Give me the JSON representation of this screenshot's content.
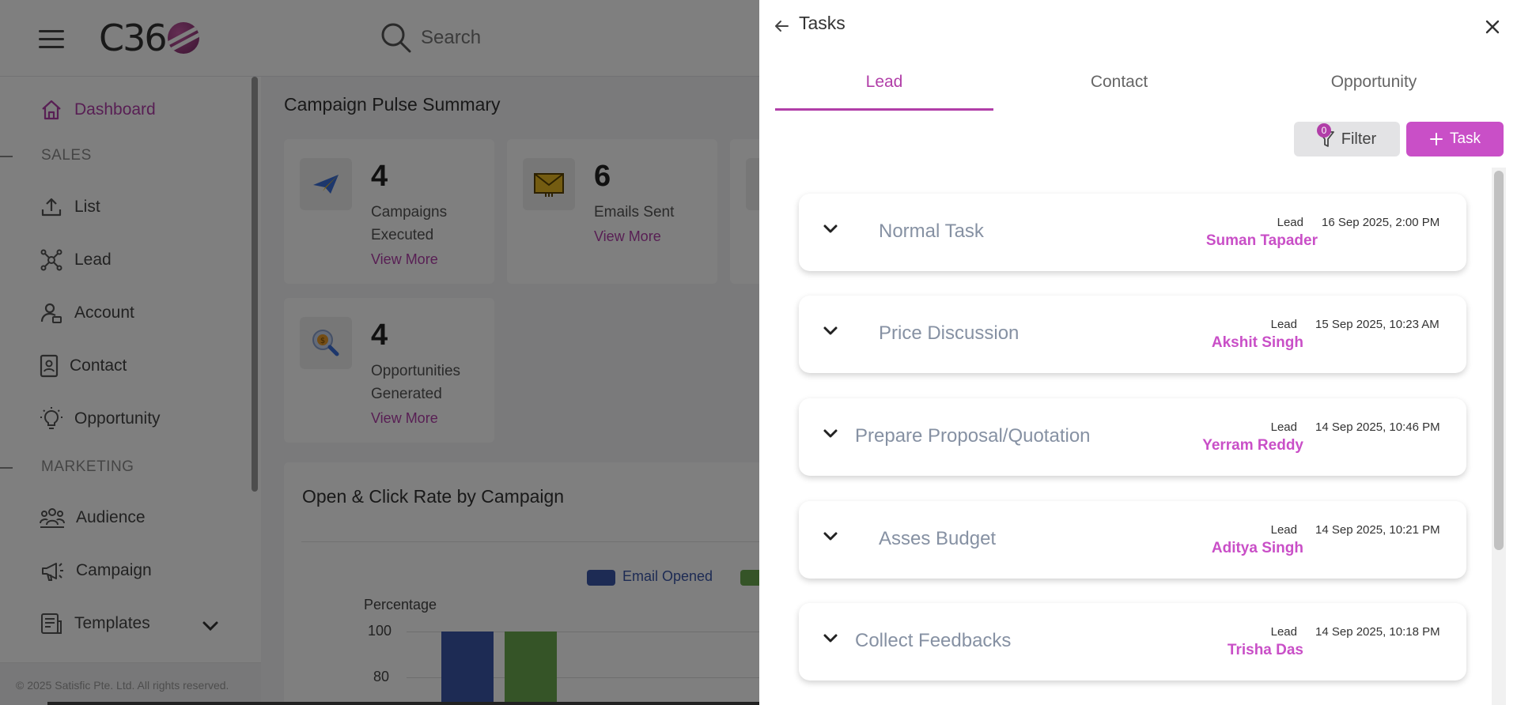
{
  "app": {
    "logo_text": "C36",
    "search_placeholder": "Search",
    "sidebar": {
      "items": [
        {
          "label": "Dashboard",
          "icon": "home-icon",
          "active": true
        },
        {
          "label": "List",
          "icon": "upload-icon"
        },
        {
          "label": "Lead",
          "icon": "network-icon"
        },
        {
          "label": "Account",
          "icon": "account-icon"
        },
        {
          "label": "Contact",
          "icon": "contact-icon"
        },
        {
          "label": "Opportunity",
          "icon": "lightbulb-icon"
        },
        {
          "label": "Audience",
          "icon": "audience-icon"
        },
        {
          "label": "Campaign",
          "icon": "megaphone-icon"
        },
        {
          "label": "Templates",
          "icon": "templates-icon"
        }
      ],
      "sections": {
        "sales": "SALES",
        "marketing": "MARKETING"
      },
      "footer": "© 2025 Satisfic Pte. Ltd. All rights reserved."
    },
    "dashboard": {
      "pulse_title": "Campaign Pulse Summary",
      "cards": [
        {
          "value": "4",
          "label": "Campaigns Executed",
          "link": "View More",
          "icon": "paper-plane-icon"
        },
        {
          "value": "6",
          "label": "Emails Sent",
          "link": "View More",
          "icon": "envelope-icon"
        },
        {
          "value": "4",
          "label": "Opportunities Generated",
          "link": "View More",
          "icon": "coin-search-icon"
        }
      ],
      "chart_title": "Open & Click Rate by Campaign",
      "legend_opened": "Email Opened",
      "ylabel": "Percentage",
      "y_ticks": [
        "100",
        "80"
      ]
    },
    "colors": {
      "accent": "#b13ea8",
      "button": "#c94fc7",
      "bar_opened": "#3a56a8",
      "bar_clicked": "#6aa84f"
    }
  },
  "drawer": {
    "title": "Tasks",
    "tabs": [
      {
        "label": "Lead",
        "active": true
      },
      {
        "label": "Contact",
        "active": false
      },
      {
        "label": "Opportunity",
        "active": false
      }
    ],
    "filter_label": "Filter",
    "filter_count": "0",
    "add_task_label": "Task",
    "tasks": [
      {
        "name": "Normal Task",
        "type": "Lead",
        "date": "16 Sep 2025, 2:00 PM",
        "owner": "Suman Tapader"
      },
      {
        "name": "Price Discussion",
        "type": "Lead",
        "date": "15 Sep 2025, 10:23 AM",
        "owner": "Akshit Singh"
      },
      {
        "name": "Prepare Proposal/Quotation",
        "type": "Lead",
        "date": "14 Sep 2025, 10:46 PM",
        "owner": "Yerram Reddy"
      },
      {
        "name": "Asses Budget",
        "type": "Lead",
        "date": "14 Sep 2025, 10:21 PM",
        "owner": "Aditya Singh"
      },
      {
        "name": "Collect Feedbacks",
        "type": "Lead",
        "date": "14 Sep 2025, 10:18 PM",
        "owner": "Trisha Das"
      }
    ]
  }
}
